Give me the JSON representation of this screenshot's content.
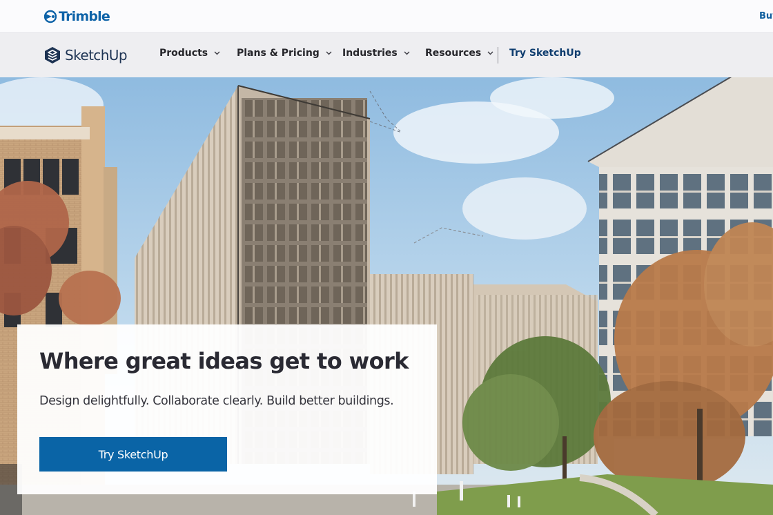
{
  "topbar": {
    "brand": "Trimble",
    "brand_icon": "trimble-logo-icon",
    "right_link": "Buy"
  },
  "nav": {
    "logo_text": "SketchUp",
    "logo_icon": "sketchup-logo-icon",
    "items": [
      {
        "label": "Products",
        "icon": "chevron-down-icon"
      },
      {
        "label": "Plans & Pricing",
        "icon": "chevron-down-icon"
      },
      {
        "label": "Industries",
        "icon": "chevron-down-icon"
      },
      {
        "label": "Resources",
        "icon": "chevron-down-icon"
      }
    ],
    "cta_label": "Try SketchUp"
  },
  "hero": {
    "title": "Where great ideas get to work",
    "subtitle": "Design delightfully. Collaborate clearly. Build better buildings.",
    "button_label": "Try SketchUp"
  },
  "colors": {
    "trimble_blue": "#0e63a8",
    "sketchup_navy": "#1d3353",
    "cta_blue": "#0a64a6",
    "nav_background": "#eeeef1",
    "nav_cta_text": "#0d3c6e"
  }
}
